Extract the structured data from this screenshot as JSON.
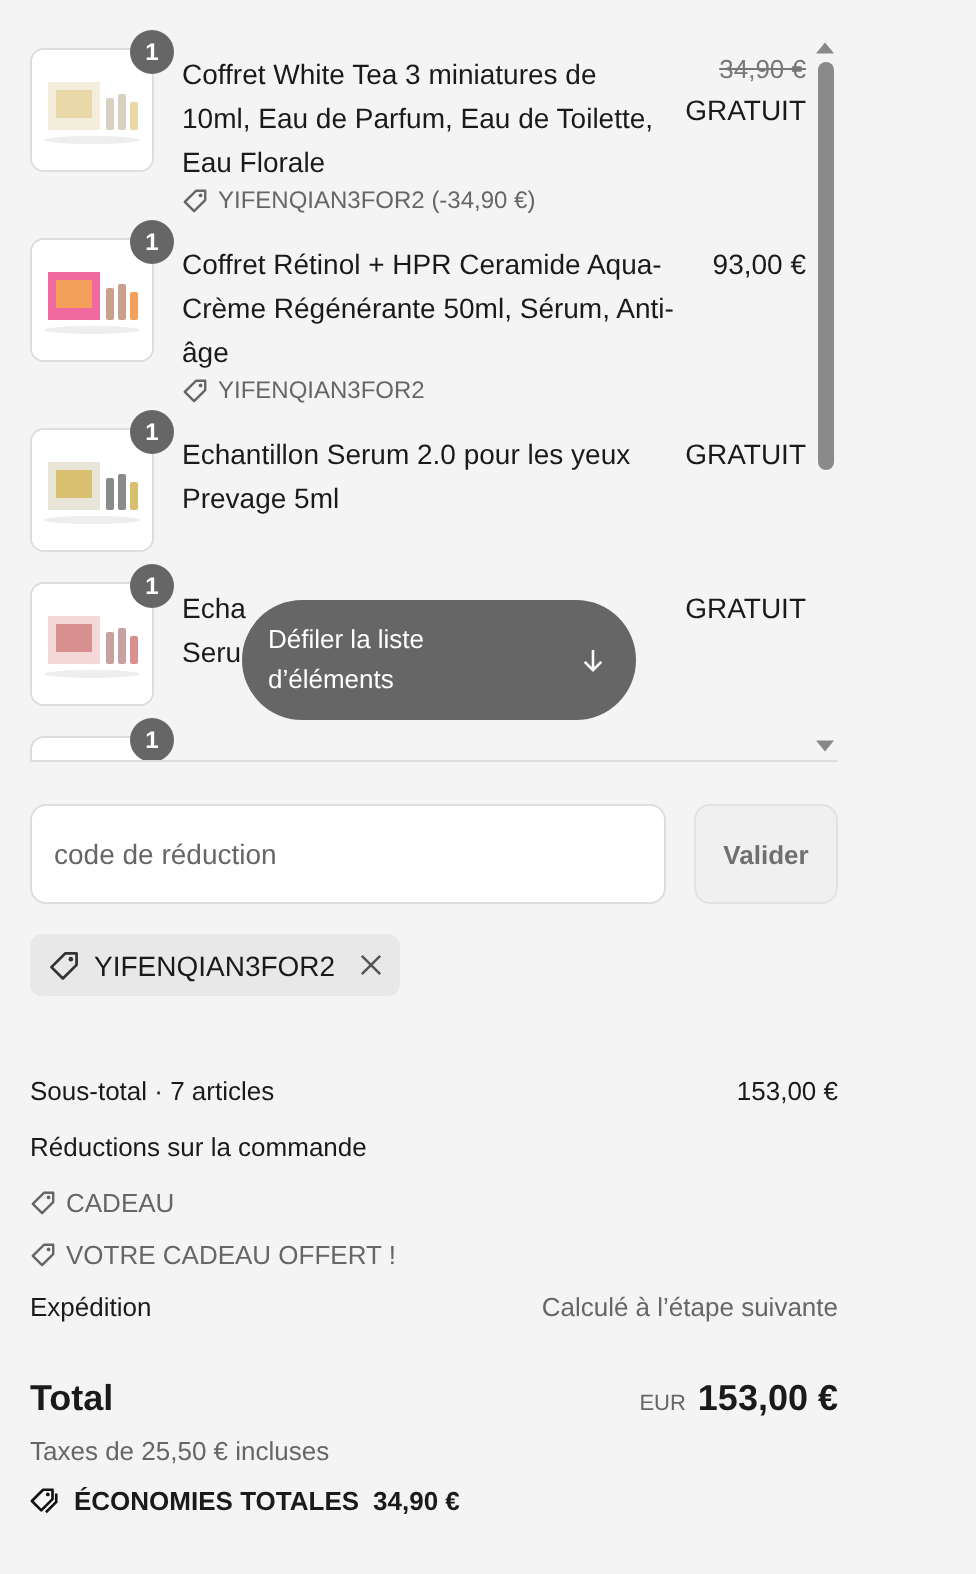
{
  "items": [
    {
      "quantity": "1",
      "title_lines": [
        "Coffret White Tea 3 miniatures de",
        "10ml, Eau de Parfum, Eau de Toilette,",
        "Eau Florale"
      ],
      "discount": "YIFENQIAN3FOR2 (-34,90 €)",
      "compare_at": "34,90 €",
      "price": "GRATUIT",
      "kind": "picture"
    },
    {
      "quantity": "1",
      "title_lines": [
        "Coffret Rétinol + HPR Ceramide Aqua-",
        "Crème Régénérante 50ml, Sérum, Anti-",
        "âge"
      ],
      "discount": "YIFENQIAN3FOR2",
      "price": "93,00 €",
      "kind": "picture"
    },
    {
      "quantity": "1",
      "title_lines": [
        "Echantillon Serum 2.0 pour les yeux",
        "Prevage 5ml"
      ],
      "price": "GRATUIT",
      "kind": "picture"
    },
    {
      "quantity": "1",
      "title_lines": [
        "Echa",
        "Seru"
      ],
      "price": "GRATUIT",
      "kind": "picture"
    },
    {
      "quantity": "1"
    }
  ],
  "scroll_hint": {
    "label": "Défiler la liste d’éléments"
  },
  "discount_field": {
    "placeholder": "code de réduction"
  },
  "apply_button": {
    "label": "Valider",
    "disabled": true
  },
  "applied_codes": [
    "YIFENQIAN3FOR2"
  ],
  "summary": {
    "subtotal_label": "Sous-total · 7 articles",
    "subtotal": "153,00 €",
    "discounts_label": "Réductions sur la commande",
    "discounts": [
      "CADEAU",
      "VOTRE CADEAU OFFERT !"
    ],
    "shipping_label": "Expédition",
    "shipping": "Calculé à l’étape suivante",
    "total_label": "Total",
    "currency": "EUR",
    "total": "153,00 €",
    "taxes": "Taxes de 25,50 € incluses",
    "savings_label": "ÉCONOMIES TOTALES",
    "savings": "34,90 €"
  }
}
